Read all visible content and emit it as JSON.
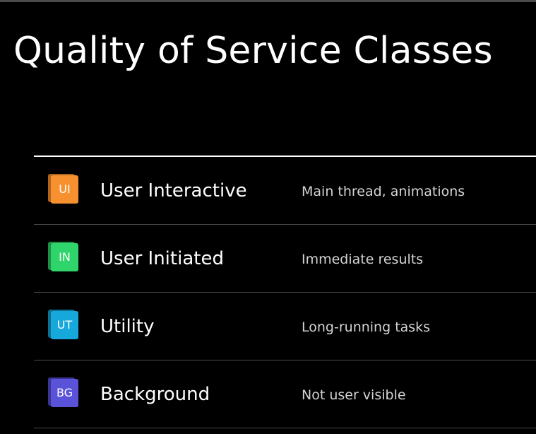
{
  "slide": {
    "title": "Quality of Service Classes"
  },
  "classes": [
    {
      "code": "UI",
      "name": "User Interactive",
      "description": "Main thread, animations",
      "color": "#f7912f",
      "shadow_color": "#b0651f"
    },
    {
      "code": "IN",
      "name": "User Initiated",
      "description": "Immediate results",
      "color": "#2fd56a",
      "shadow_color": "#1f8f47"
    },
    {
      "code": "UT",
      "name": "Utility",
      "description": "Long-running tasks",
      "color": "#16a7db",
      "shadow_color": "#0e6f92"
    },
    {
      "code": "BG",
      "name": "Background",
      "description": "Not user visible",
      "color": "#5a52d8",
      "shadow_color": "#3b3591"
    }
  ]
}
